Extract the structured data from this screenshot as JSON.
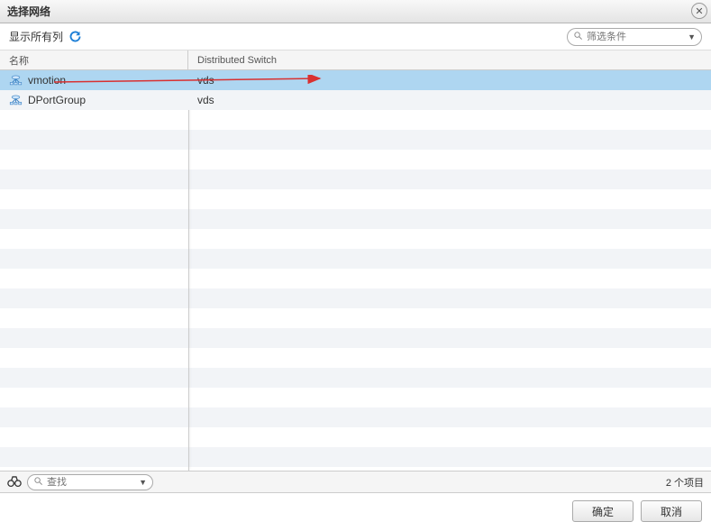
{
  "dialog": {
    "title": "选择网络"
  },
  "toolbar": {
    "show_all_cols": "显示所有列",
    "filter_placeholder": "筛选条件"
  },
  "columns": {
    "name": "名称",
    "ds": "Distributed Switch"
  },
  "rows": [
    {
      "name": "vmotion",
      "ds": "vds",
      "selected": true
    },
    {
      "name": "DPortGroup",
      "ds": "vds",
      "selected": false
    }
  ],
  "footer": {
    "search_placeholder": "查找",
    "item_count": "2 个项目"
  },
  "buttons": {
    "ok": "确定",
    "cancel": "取消"
  }
}
